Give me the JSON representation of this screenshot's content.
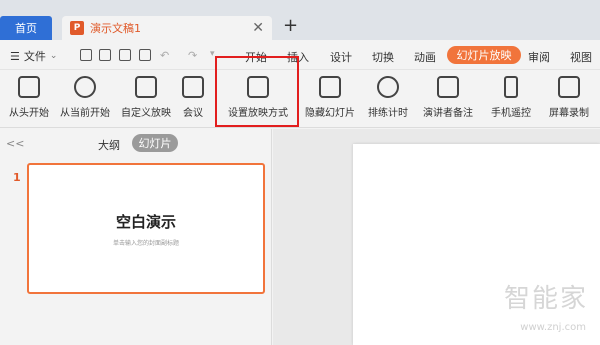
{
  "tabs": {
    "home": "首页",
    "doc_title": "演示文稿1",
    "close": "✕",
    "add": "+"
  },
  "menu": {
    "file": "文件",
    "items": [
      "开始",
      "插入",
      "设计",
      "切换",
      "动画",
      "幻灯片放映",
      "审阅",
      "视图"
    ],
    "active_index": 5
  },
  "ribbon": {
    "buttons": [
      {
        "label": "从头开始",
        "icon": "play-from-start-icon"
      },
      {
        "label": "从当前开始",
        "icon": "play-current-icon"
      },
      {
        "label": "自定义放映",
        "icon": "custom-show-icon"
      },
      {
        "label": "会议",
        "icon": "meeting-icon"
      },
      {
        "label": "设置放映方式",
        "icon": "slideshow-settings-icon"
      },
      {
        "label": "隐藏幻灯片",
        "icon": "hide-slide-icon"
      },
      {
        "label": "排练计时",
        "icon": "rehearse-timer-icon"
      },
      {
        "label": "演讲者备注",
        "icon": "speaker-notes-icon"
      },
      {
        "label": "手机遥控",
        "icon": "phone-remote-icon"
      },
      {
        "label": "屏幕录制",
        "icon": "screen-record-icon"
      }
    ]
  },
  "panel": {
    "outline": "大纲",
    "slides": "幻灯片",
    "collapse": "<<"
  },
  "thumbnail": {
    "number": "1",
    "title": "空白演示",
    "subtitle": "单击输入您的封面副标题"
  },
  "watermark": {
    "main": "智能家",
    "url": "www.znj.com"
  },
  "colors": {
    "accent": "#f1743b",
    "home_tab": "#2f6fd6",
    "highlight": "#e21e1e"
  }
}
